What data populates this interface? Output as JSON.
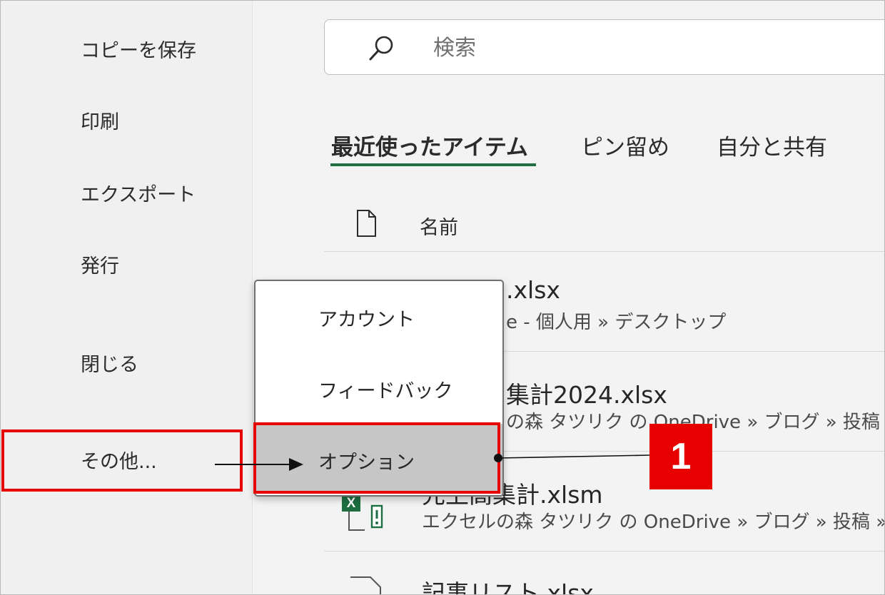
{
  "sidebar": {
    "items": [
      {
        "label": "コピーを保存"
      },
      {
        "label": "印刷"
      },
      {
        "label": "エクスポート"
      },
      {
        "label": "発行"
      },
      {
        "label": "閉じる"
      },
      {
        "label": "その他..."
      }
    ]
  },
  "search": {
    "placeholder": "検索",
    "icon": "search-icon"
  },
  "tabs": [
    {
      "label": "最近使ったアイテム",
      "active": true
    },
    {
      "label": "ピン留め",
      "active": false
    },
    {
      "label": "自分と共有",
      "active": false
    }
  ],
  "list": {
    "column_header": "名前",
    "files": [
      {
        "name": ".xlsx",
        "path": "e - 個人用 » デスクトップ"
      },
      {
        "name": "集計2024.xlsx",
        "path": "の森 タツリク の OneDrive » ブログ » 投稿 »"
      },
      {
        "name": "先上高集計.xlsm",
        "path": "エクセルの森 タツリク の OneDrive » ブログ » 投稿 »"
      },
      {
        "name": "記事リスト.xlsx",
        "path": ""
      }
    ]
  },
  "menu": {
    "items": [
      {
        "label": "アカウント",
        "selected": false
      },
      {
        "label": "フィードバック",
        "selected": false
      },
      {
        "label": "オプション",
        "selected": true
      }
    ]
  },
  "annotation": {
    "badge": "1",
    "color": "#e60000"
  },
  "colors": {
    "accent": "#1e7145",
    "excel_green": "#1d6f42",
    "highlight": "#e60000"
  }
}
